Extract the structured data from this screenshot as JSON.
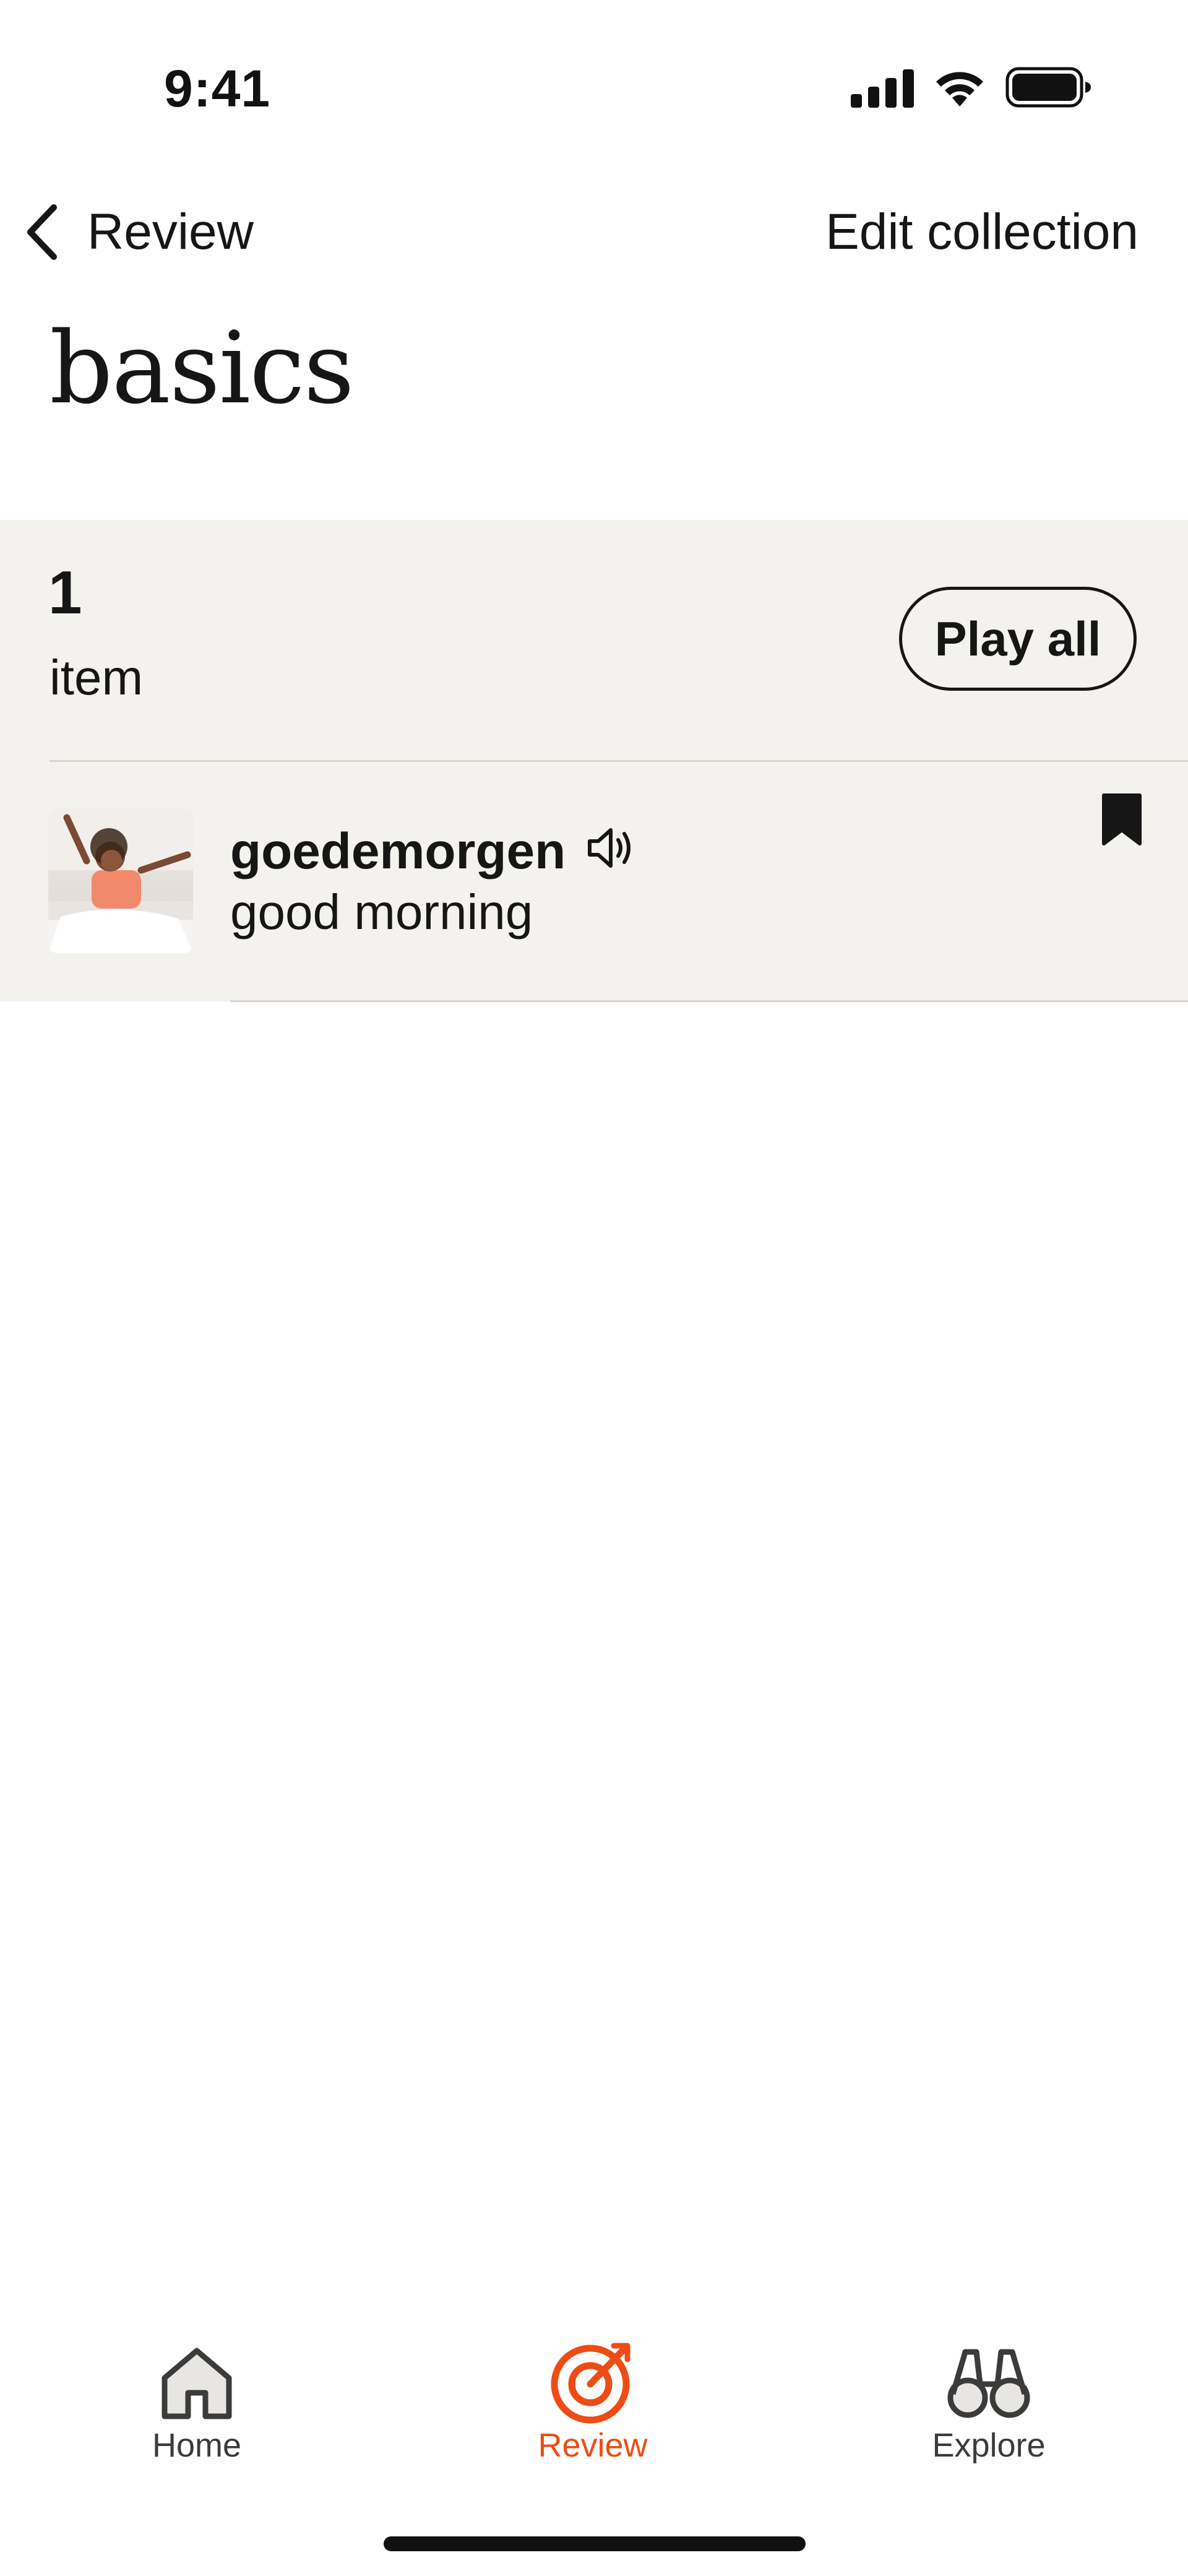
{
  "status_bar": {
    "time": "9:41",
    "icons": [
      "cellular-signal-icon",
      "wifi-icon",
      "battery-icon"
    ]
  },
  "nav": {
    "back_label": "Review",
    "edit_label": "Edit collection"
  },
  "page": {
    "title": "basics"
  },
  "collection": {
    "count": "1",
    "count_label": "item",
    "play_all_label": "Play all",
    "items": [
      {
        "term": "goedemorgen",
        "translation": "good morning",
        "bookmarked": true
      }
    ]
  },
  "tab_bar": {
    "active": "Review",
    "accent_color": "#ee4c14",
    "tabs": [
      {
        "label": "Home",
        "icon": "house-icon"
      },
      {
        "label": "Review",
        "icon": "target-icon"
      },
      {
        "label": "Explore",
        "icon": "binoculars-icon"
      }
    ]
  },
  "colors": {
    "panel_background": "#f4f2ee",
    "text": "#161616",
    "accent": "#ee4c14"
  }
}
